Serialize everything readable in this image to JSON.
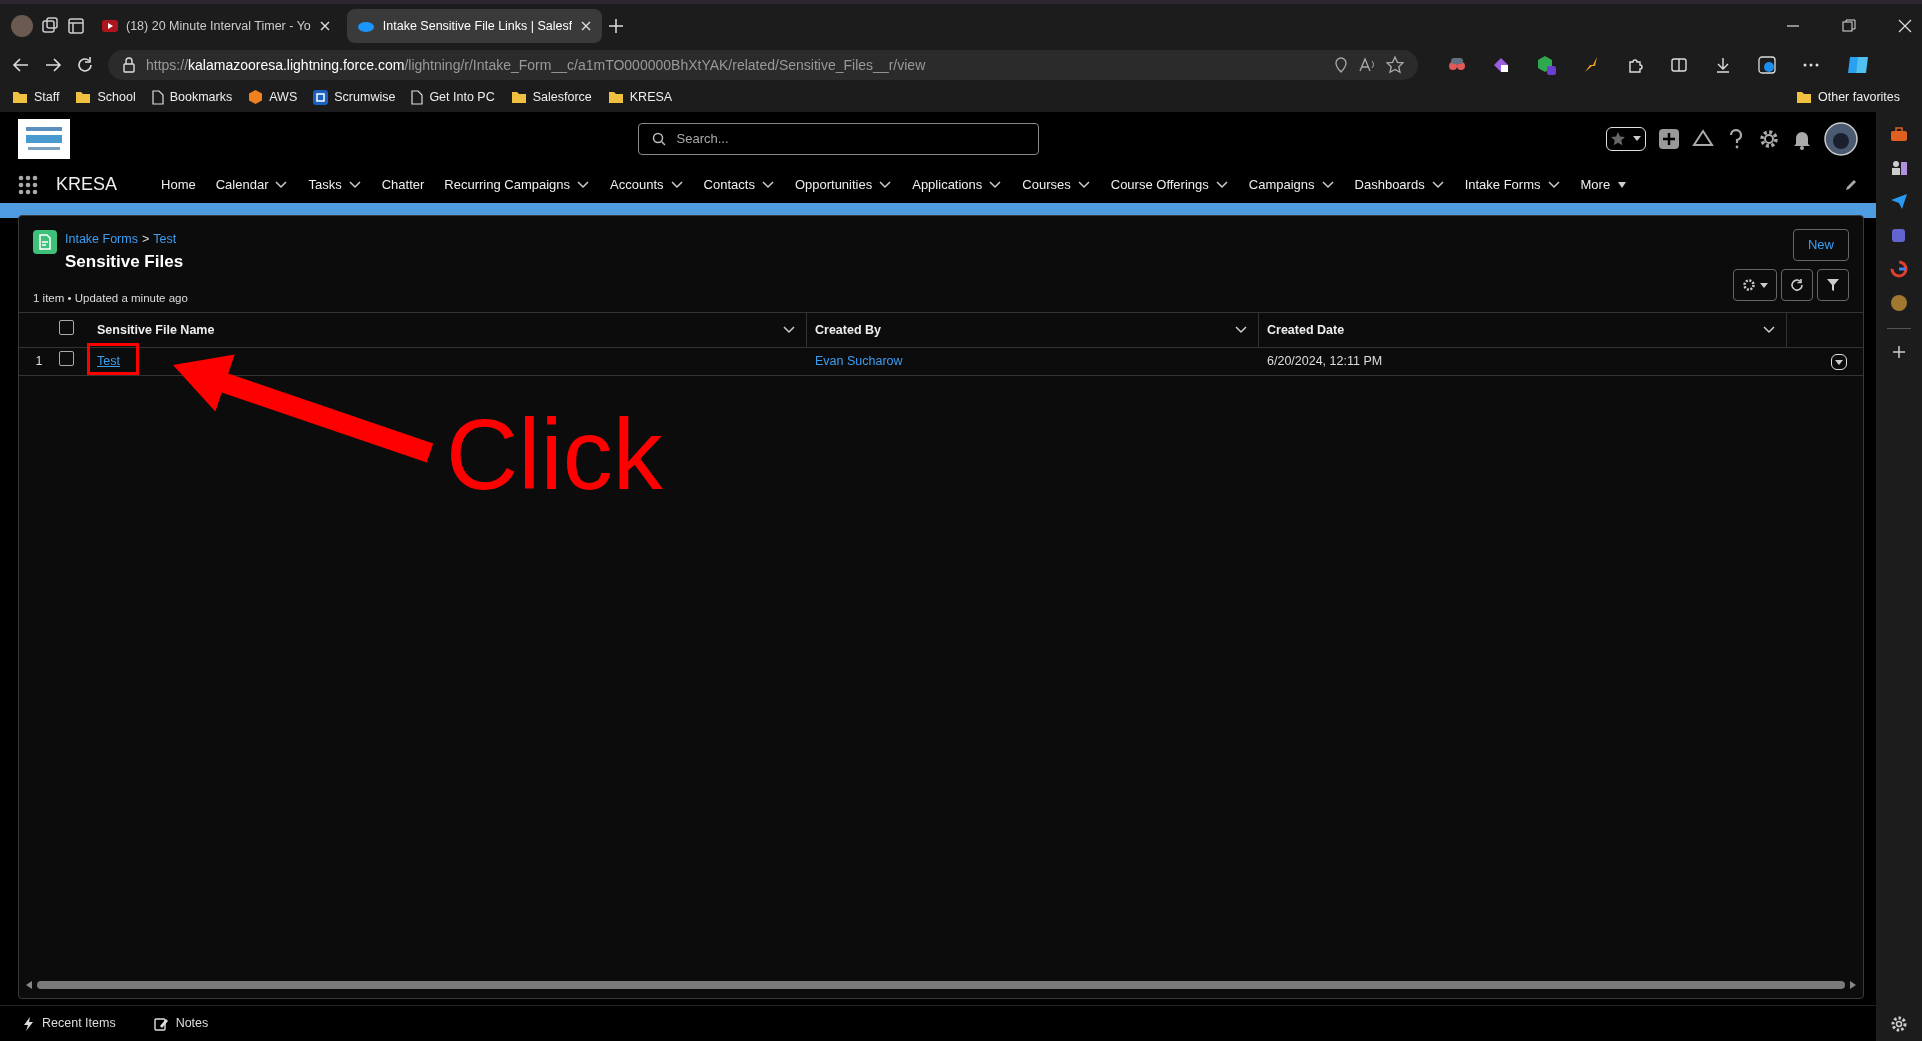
{
  "browser": {
    "tabs": [
      {
        "title": "(18) 20 Minute Interval Timer - Yo",
        "kind": "video",
        "selected": false
      },
      {
        "title": "Intake Sensitive File Links | Salesf",
        "kind": "cloud",
        "selected": true
      }
    ],
    "address": {
      "scheme": "https://",
      "host": "kalamazooresa.lightning.force.com",
      "path": "/lightning/r/Intake_Form__c/a1mTO000000BhXtYAK/related/Sensitive_Files__r/view"
    },
    "bookmarks": [
      {
        "label": "Staff",
        "kind": "folder"
      },
      {
        "label": "School",
        "kind": "folder"
      },
      {
        "label": "Bookmarks",
        "kind": "page"
      },
      {
        "label": "AWS",
        "kind": "cube"
      },
      {
        "label": "Scrumwise",
        "kind": "badge"
      },
      {
        "label": "Get Into PC",
        "kind": "page"
      },
      {
        "label": "Salesforce",
        "kind": "folder"
      },
      {
        "label": "KRESA",
        "kind": "folder"
      }
    ],
    "other_favorites": "Other favorites"
  },
  "app": {
    "name": "KRESA",
    "search": {
      "placeholder": "Search..."
    },
    "nav": [
      {
        "label": "Home",
        "menu": false
      },
      {
        "label": "Calendar",
        "menu": true
      },
      {
        "label": "Tasks",
        "menu": true
      },
      {
        "label": "Chatter",
        "menu": false
      },
      {
        "label": "Recurring Campaigns",
        "menu": true
      },
      {
        "label": "Accounts",
        "menu": true
      },
      {
        "label": "Contacts",
        "menu": true
      },
      {
        "label": "Opportunities",
        "menu": true
      },
      {
        "label": "Applications",
        "menu": true
      },
      {
        "label": "Courses",
        "menu": true
      },
      {
        "label": "Course Offerings",
        "menu": true
      },
      {
        "label": "Campaigns",
        "menu": true
      },
      {
        "label": "Dashboards",
        "menu": true
      },
      {
        "label": "Intake Forms",
        "menu": true
      },
      {
        "label": "More",
        "menu": true
      }
    ]
  },
  "list": {
    "breadcrumb": [
      "Intake Forms",
      "Test"
    ],
    "separator": ">",
    "title": "Sensitive Files",
    "meta": "1 item • Updated a minute ago",
    "new_button": "New",
    "select_all": {
      "checked": false
    },
    "columns": [
      {
        "label": "Sensitive File Name"
      },
      {
        "label": "Created By"
      },
      {
        "label": "Created Date"
      }
    ],
    "rows": [
      {
        "number": "1",
        "checked": false,
        "name": "Test",
        "created_by": "Evan Sucharow",
        "created_date": "6/20/2024, 12:11 PM"
      }
    ]
  },
  "annotation": {
    "label": "Click"
  },
  "utility_bar": [
    "Recent Items",
    "Notes"
  ]
}
